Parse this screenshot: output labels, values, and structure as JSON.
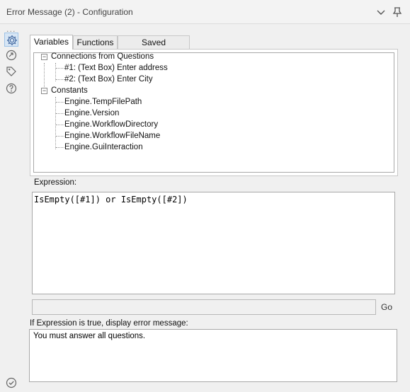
{
  "window": {
    "title": "Error Message (2) - Configuration",
    "icons": [
      "chevron-down-icon",
      "pin-icon"
    ]
  },
  "sidebar": {
    "more_label": "...",
    "icons": [
      "gear-icon",
      "connection-icon",
      "tag-icon",
      "help-icon",
      "check-circle-icon"
    ]
  },
  "tabs": [
    {
      "label": "Variables",
      "active": true
    },
    {
      "label": "Functions",
      "active": false
    },
    {
      "label": "Saved Expressions",
      "active": false
    }
  ],
  "tree": {
    "groups": [
      {
        "label": "Connections from Questions",
        "expander": "−",
        "items": [
          "#1: (Text Box) Enter address",
          "#2: (Text Box) Enter City"
        ]
      },
      {
        "label": "Constants",
        "expander": "−",
        "items": [
          "Engine.TempFilePath",
          "Engine.Version",
          "Engine.WorkflowDirectory",
          "Engine.WorkflowFileName",
          "Engine.GuiInteraction"
        ]
      }
    ]
  },
  "expression": {
    "label": "Expression:",
    "value": "IsEmpty([#1]) or IsEmpty([#2])"
  },
  "go": {
    "input_value": "",
    "button_label": "Go"
  },
  "error_message": {
    "label": "If Expression is true, display error message:",
    "value": "You must answer all questions."
  },
  "colors": {
    "background": "#f0f0f0",
    "accent": "#2b6cb0",
    "active_icon_bg": "#d7e6f5"
  }
}
